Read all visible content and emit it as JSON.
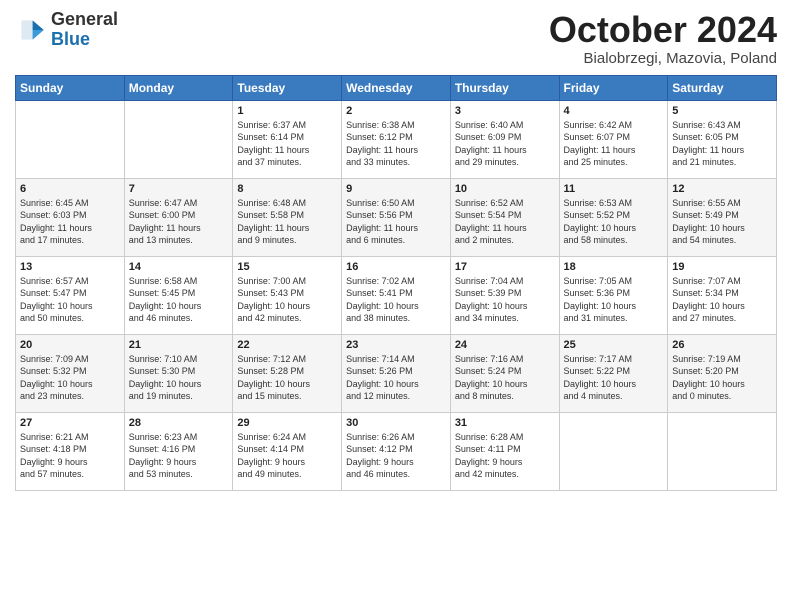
{
  "header": {
    "logo_line1": "General",
    "logo_line2": "Blue",
    "month": "October 2024",
    "location": "Bialobrzegi, Mazovia, Poland"
  },
  "weekdays": [
    "Sunday",
    "Monday",
    "Tuesday",
    "Wednesday",
    "Thursday",
    "Friday",
    "Saturday"
  ],
  "weeks": [
    [
      {
        "day": "",
        "info": ""
      },
      {
        "day": "",
        "info": ""
      },
      {
        "day": "1",
        "info": "Sunrise: 6:37 AM\nSunset: 6:14 PM\nDaylight: 11 hours\nand 37 minutes."
      },
      {
        "day": "2",
        "info": "Sunrise: 6:38 AM\nSunset: 6:12 PM\nDaylight: 11 hours\nand 33 minutes."
      },
      {
        "day": "3",
        "info": "Sunrise: 6:40 AM\nSunset: 6:09 PM\nDaylight: 11 hours\nand 29 minutes."
      },
      {
        "day": "4",
        "info": "Sunrise: 6:42 AM\nSunset: 6:07 PM\nDaylight: 11 hours\nand 25 minutes."
      },
      {
        "day": "5",
        "info": "Sunrise: 6:43 AM\nSunset: 6:05 PM\nDaylight: 11 hours\nand 21 minutes."
      }
    ],
    [
      {
        "day": "6",
        "info": "Sunrise: 6:45 AM\nSunset: 6:03 PM\nDaylight: 11 hours\nand 17 minutes."
      },
      {
        "day": "7",
        "info": "Sunrise: 6:47 AM\nSunset: 6:00 PM\nDaylight: 11 hours\nand 13 minutes."
      },
      {
        "day": "8",
        "info": "Sunrise: 6:48 AM\nSunset: 5:58 PM\nDaylight: 11 hours\nand 9 minutes."
      },
      {
        "day": "9",
        "info": "Sunrise: 6:50 AM\nSunset: 5:56 PM\nDaylight: 11 hours\nand 6 minutes."
      },
      {
        "day": "10",
        "info": "Sunrise: 6:52 AM\nSunset: 5:54 PM\nDaylight: 11 hours\nand 2 minutes."
      },
      {
        "day": "11",
        "info": "Sunrise: 6:53 AM\nSunset: 5:52 PM\nDaylight: 10 hours\nand 58 minutes."
      },
      {
        "day": "12",
        "info": "Sunrise: 6:55 AM\nSunset: 5:49 PM\nDaylight: 10 hours\nand 54 minutes."
      }
    ],
    [
      {
        "day": "13",
        "info": "Sunrise: 6:57 AM\nSunset: 5:47 PM\nDaylight: 10 hours\nand 50 minutes."
      },
      {
        "day": "14",
        "info": "Sunrise: 6:58 AM\nSunset: 5:45 PM\nDaylight: 10 hours\nand 46 minutes."
      },
      {
        "day": "15",
        "info": "Sunrise: 7:00 AM\nSunset: 5:43 PM\nDaylight: 10 hours\nand 42 minutes."
      },
      {
        "day": "16",
        "info": "Sunrise: 7:02 AM\nSunset: 5:41 PM\nDaylight: 10 hours\nand 38 minutes."
      },
      {
        "day": "17",
        "info": "Sunrise: 7:04 AM\nSunset: 5:39 PM\nDaylight: 10 hours\nand 34 minutes."
      },
      {
        "day": "18",
        "info": "Sunrise: 7:05 AM\nSunset: 5:36 PM\nDaylight: 10 hours\nand 31 minutes."
      },
      {
        "day": "19",
        "info": "Sunrise: 7:07 AM\nSunset: 5:34 PM\nDaylight: 10 hours\nand 27 minutes."
      }
    ],
    [
      {
        "day": "20",
        "info": "Sunrise: 7:09 AM\nSunset: 5:32 PM\nDaylight: 10 hours\nand 23 minutes."
      },
      {
        "day": "21",
        "info": "Sunrise: 7:10 AM\nSunset: 5:30 PM\nDaylight: 10 hours\nand 19 minutes."
      },
      {
        "day": "22",
        "info": "Sunrise: 7:12 AM\nSunset: 5:28 PM\nDaylight: 10 hours\nand 15 minutes."
      },
      {
        "day": "23",
        "info": "Sunrise: 7:14 AM\nSunset: 5:26 PM\nDaylight: 10 hours\nand 12 minutes."
      },
      {
        "day": "24",
        "info": "Sunrise: 7:16 AM\nSunset: 5:24 PM\nDaylight: 10 hours\nand 8 minutes."
      },
      {
        "day": "25",
        "info": "Sunrise: 7:17 AM\nSunset: 5:22 PM\nDaylight: 10 hours\nand 4 minutes."
      },
      {
        "day": "26",
        "info": "Sunrise: 7:19 AM\nSunset: 5:20 PM\nDaylight: 10 hours\nand 0 minutes."
      }
    ],
    [
      {
        "day": "27",
        "info": "Sunrise: 6:21 AM\nSunset: 4:18 PM\nDaylight: 9 hours\nand 57 minutes."
      },
      {
        "day": "28",
        "info": "Sunrise: 6:23 AM\nSunset: 4:16 PM\nDaylight: 9 hours\nand 53 minutes."
      },
      {
        "day": "29",
        "info": "Sunrise: 6:24 AM\nSunset: 4:14 PM\nDaylight: 9 hours\nand 49 minutes."
      },
      {
        "day": "30",
        "info": "Sunrise: 6:26 AM\nSunset: 4:12 PM\nDaylight: 9 hours\nand 46 minutes."
      },
      {
        "day": "31",
        "info": "Sunrise: 6:28 AM\nSunset: 4:11 PM\nDaylight: 9 hours\nand 42 minutes."
      },
      {
        "day": "",
        "info": ""
      },
      {
        "day": "",
        "info": ""
      }
    ]
  ]
}
